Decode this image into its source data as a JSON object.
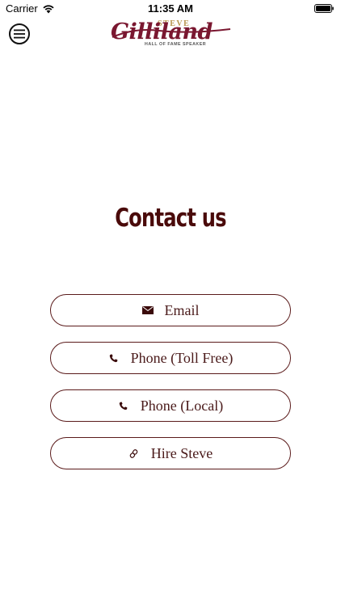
{
  "status_bar": {
    "carrier": "Carrier",
    "time": "11:35 AM"
  },
  "header": {
    "menu_icon": "hamburger-menu-icon",
    "logo": {
      "top_text": "STEVE",
      "main_text": "Gilliland",
      "sub_text": "HALL OF FAME SPEAKER"
    }
  },
  "main": {
    "title": "Contact us",
    "buttons": [
      {
        "label": "Email",
        "icon": "envelope-icon"
      },
      {
        "label": "Phone (Toll Free)",
        "icon": "phone-icon"
      },
      {
        "label": "Phone (Local)",
        "icon": "phone-icon"
      },
      {
        "label": "Hire Steve",
        "icon": "link-icon"
      }
    ]
  },
  "colors": {
    "brand_maroon": "#7a1730",
    "heading": "#4a0a0a",
    "gold": "#b7954e",
    "button_border": "#5a1a1a"
  }
}
